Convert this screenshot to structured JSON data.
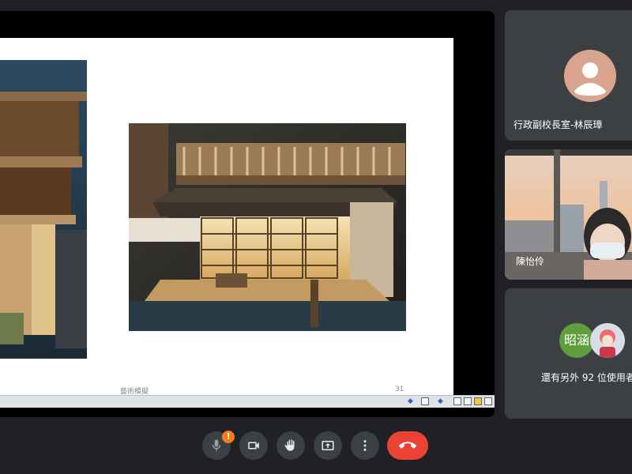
{
  "slide": {
    "footer_left": "藝術模擬",
    "page_number": "31"
  },
  "participants": {
    "p1_name": "行政副校長室-林辰璋",
    "p2_name": "陳怡伶",
    "more_avatar_text": "昭涵",
    "more_text": "還有另外 92 位使用者"
  },
  "controls": {
    "mic_badge": "!",
    "mic_icon": "mic-off-icon",
    "camera_icon": "videocam-icon",
    "hand_icon": "raise-hand-icon",
    "present_icon": "present-screen-icon",
    "more_icon": "more-vert-icon",
    "end_icon": "call-end-icon"
  },
  "colors": {
    "end_call": "#ea4335",
    "badge": "#fa7b17",
    "avatar_green": "#5f9e3c",
    "avatar_tan": "#d9a48d"
  }
}
